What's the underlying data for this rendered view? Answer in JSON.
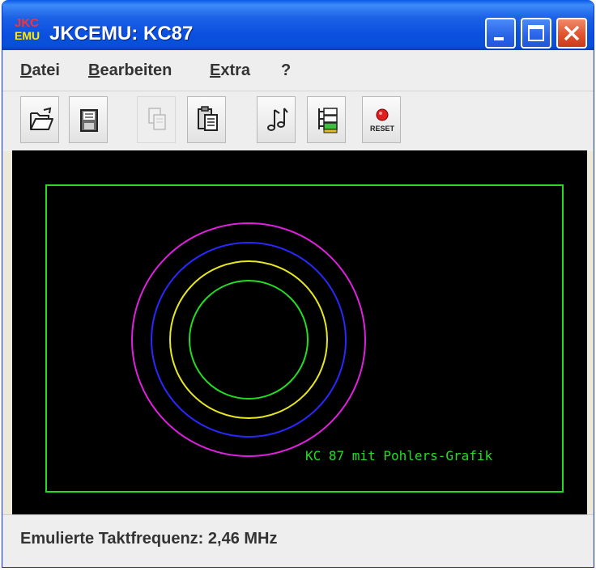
{
  "window": {
    "title": "JKCEMU: KC87",
    "app_icon": {
      "line1": "JKC",
      "line2": "EMU"
    },
    "controls": {
      "minimize": "minimize-icon",
      "maximize": "maximize-icon",
      "close": "close-icon"
    }
  },
  "menu": {
    "items": [
      {
        "mnemonic": "D",
        "rest": "atei"
      },
      {
        "mnemonic": "B",
        "rest": "earbeiten"
      },
      {
        "mnemonic": "E",
        "rest": "xtra"
      },
      {
        "mnemonic": "",
        "rest": "?"
      }
    ]
  },
  "toolbar": {
    "buttons": [
      {
        "icon": "open-folder-icon",
        "enabled": true
      },
      {
        "icon": "save-disk-icon",
        "enabled": true
      },
      {
        "icon": "copy-icon",
        "enabled": false
      },
      {
        "icon": "paste-clipboard-icon",
        "enabled": true
      },
      {
        "icon": "music-note-icon",
        "enabled": true
      },
      {
        "icon": "memory-editor-icon",
        "enabled": true
      },
      {
        "icon": "reset-icon",
        "enabled": true,
        "label": "RESET"
      }
    ]
  },
  "screen": {
    "background": "#000000",
    "frame_color": "#22dd22",
    "ring_colors": [
      "#e020e0",
      "#2828ff",
      "#e8e820",
      "#22dd22"
    ],
    "text": "KC 87 mit Pohlers-Grafik"
  },
  "status": {
    "text": "Emulierte Taktfrequenz: 2,46 MHz"
  }
}
